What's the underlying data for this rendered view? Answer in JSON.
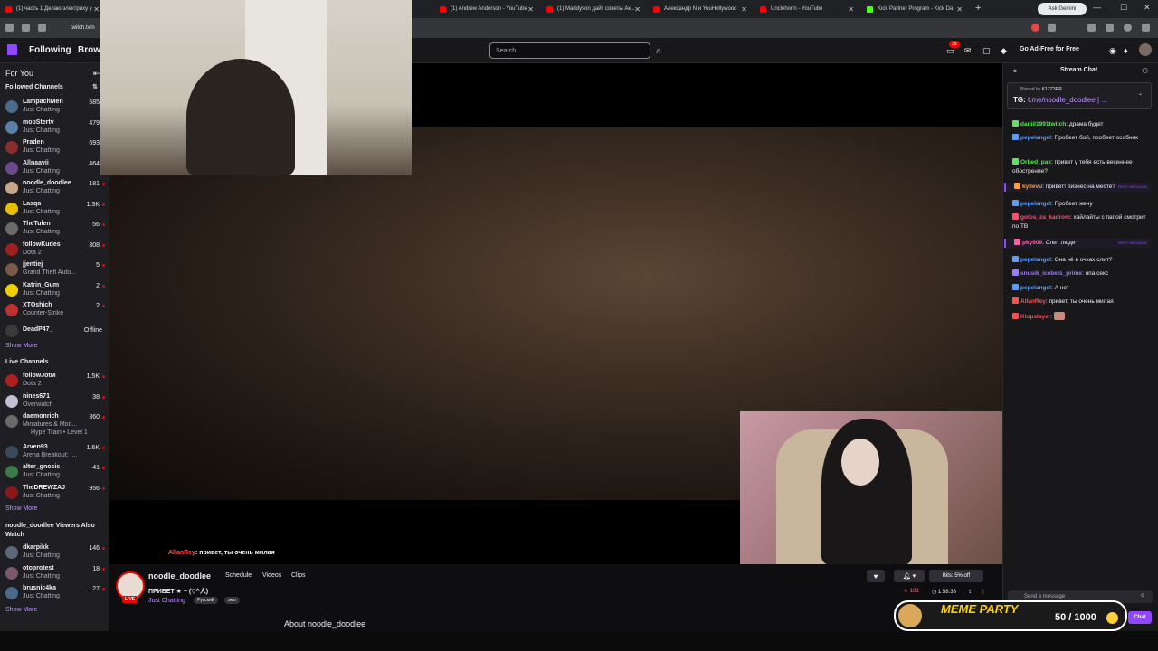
{
  "browser": {
    "tabs": [
      {
        "title": "(1) часть 1 Делаю электриху у",
        "icon": "youtube-icon"
      },
      {
        "title": "(1) Andrew Anderson - YouTube",
        "icon": "youtube-icon"
      },
      {
        "title": "(1) Maddyson дайт советы Ак...",
        "icon": "youtube-icon"
      },
      {
        "title": "Александр N и YouHollywood",
        "icon": "youtube-icon"
      },
      {
        "title": "Unclehonn - YouTube",
        "icon": "youtube-icon"
      },
      {
        "title": "Kick Partner Program - Kick Da",
        "icon": "kick-icon"
      }
    ],
    "gemini_label": "Ask Gemini",
    "address": "twitch.tv/n"
  },
  "topnav": {
    "following": "Following",
    "browse": "Brows",
    "search_placeholder": "Search",
    "notif_count": "39",
    "adfree_label": "Go Ad-Free for Free"
  },
  "sidebar": {
    "for_you": "For You",
    "followed_header": "Followed Channels",
    "followed": [
      {
        "name": "LampachMen",
        "game": "Just Chatting",
        "viewers": "585",
        "color": "#4a6b8a"
      },
      {
        "name": "mobStertv",
        "game": "Just Chatting",
        "viewers": "479",
        "color": "#5b7fa8"
      },
      {
        "name": "Praden",
        "game": "Just Chatting",
        "viewers": "693",
        "color": "#8a2c2c"
      },
      {
        "name": "Allnaavii",
        "game": "Just Chatting",
        "viewers": "464",
        "color": "#6a4a8a"
      },
      {
        "name": "noodle_doodlee",
        "game": "Just Chatting",
        "viewers": "181",
        "color": "#c9a58b"
      },
      {
        "name": "Lasqa",
        "game": "Just Chatting",
        "viewers": "1.3K",
        "color": "#e6c000"
      },
      {
        "name": "TheTulen",
        "game": "Just Chatting",
        "viewers": "56",
        "color": "#6b6b6b"
      },
      {
        "name": "followKudes",
        "game": "Dota 2",
        "viewers": "308",
        "color": "#a02020"
      },
      {
        "name": "jjentiej",
        "game": "Grand Theft Auto...",
        "viewers": "5",
        "color": "#7a5a4a"
      },
      {
        "name": "Katrin_Gum",
        "game": "Just Chatting",
        "viewers": "2",
        "color": "#f0d000"
      },
      {
        "name": "XTOshich",
        "game": "Counter-Strike",
        "viewers": "2",
        "color": "#c03030"
      },
      {
        "name": "DeadP47_",
        "game": "",
        "viewers": "Offline",
        "color": "#3a3a3a"
      }
    ],
    "show_more": "Show More",
    "live_header": "Live Channels",
    "live": [
      {
        "name": "followJotM",
        "game": "Dota 2",
        "viewers": "1.5K",
        "color": "#b02020"
      },
      {
        "name": "nines671",
        "game": "Overwatch",
        "viewers": "38",
        "color": "#c0c0d0"
      },
      {
        "name": "daemonrich",
        "game": "Miniatures & Mod...",
        "extra": "Hype Train • Level 1",
        "viewers": "360",
        "color": "#6a6a6a"
      },
      {
        "name": "Arven93",
        "game": "Arena Breakout: I...",
        "viewers": "1.6K",
        "color": "#3a4a5a"
      },
      {
        "name": "alter_gnosis",
        "game": "Just Chatting",
        "viewers": "41",
        "color": "#3a7a4a"
      },
      {
        "name": "TheDREWZAJ",
        "game": "Just Chatting",
        "viewers": "956",
        "color": "#8a1a1a"
      }
    ],
    "also_header": "noodle_doodlee Viewers Also Watch",
    "also": [
      {
        "name": "dkarpikk",
        "game": "Just Chatting",
        "viewers": "146",
        "color": "#5a6a7a"
      },
      {
        "name": "otoprotest",
        "game": "Just Chatting",
        "viewers": "18",
        "color": "#7a5a6a"
      },
      {
        "name": "brusnic4ka",
        "game": "Just Chatting",
        "viewers": "27",
        "color": "#4a6a8a"
      }
    ]
  },
  "player": {
    "overlay_user": "AllanRey",
    "overlay_msg": "привет, ты очень милая"
  },
  "channel": {
    "name": "noodle_doodlee",
    "live": "LIVE",
    "tabs": [
      "Schedule",
      "Videos",
      "Clips"
    ],
    "title": "ПРИВЕТ ★ ~ (▽^人)",
    "category": "Just Chatting",
    "tags": [
      "Русский",
      "эмо"
    ],
    "about": "About noodle_doodlee",
    "bits": "Bits: 5% off",
    "viewers": "181",
    "uptime": "1:58:38"
  },
  "chat": {
    "title": "Stream Chat",
    "pinned_by": "Pinned by",
    "pinned_user": "K1ZZ3RR",
    "pinned_text_prefix": "TG: ",
    "pinned_link": "t.me/noodle_doodlee | ...",
    "messages": [
      {
        "user": "daniil1991twitch",
        "color": "#5ae65a",
        "text": "драма будет",
        "hl": false
      },
      {
        "user": "pepelangel",
        "color": "#5b9cff",
        "text": "Пробеет бой, пробеет особняк",
        "hl": false
      },
      {
        "user": "Orbed_pax",
        "color": "#5ae65a",
        "text": "привет у тебя есть весеннее обострение?",
        "hl": false
      },
      {
        "user": "kyllevu",
        "color": "#ff9f40",
        "text": "привет! бизнес на месте?",
        "hl": true,
        "tag": "FIRST MESSAGE"
      },
      {
        "user": "pepelangel",
        "color": "#5b9cff",
        "text": "Пробеет жену",
        "hl": false
      },
      {
        "user": "golos_za_kadrom",
        "color": "#ff4f6f",
        "text": "хайлайты с папой смотрит по ТВ",
        "hl": false
      },
      {
        "user": "pky909",
        "color": "#ff5fa0",
        "text": "Слит люди",
        "hl": true,
        "tag": "FIRST MESSAGE"
      },
      {
        "user": "pepelangel",
        "color": "#5b9cff",
        "text": "Она чё в очках слит?",
        "hl": false
      },
      {
        "user": "snusik_icebets_prime",
        "color": "#9a7aff",
        "text": "опа секс",
        "hl": false
      },
      {
        "user": "pepelangel",
        "color": "#5b9cff",
        "text": "А нет",
        "hl": false
      },
      {
        "user": "AllanRey",
        "color": "#ff4f4f",
        "text": "привет, ты очень милая",
        "hl": false
      },
      {
        "user": "Klopslayer",
        "color": "#ff4f4f",
        "text": "",
        "hl": false
      }
    ],
    "input_placeholder": "Send a message",
    "chat_button": "Chat"
  },
  "meme_party": {
    "title": "MEME PARTY",
    "score": "50 / 1000"
  }
}
